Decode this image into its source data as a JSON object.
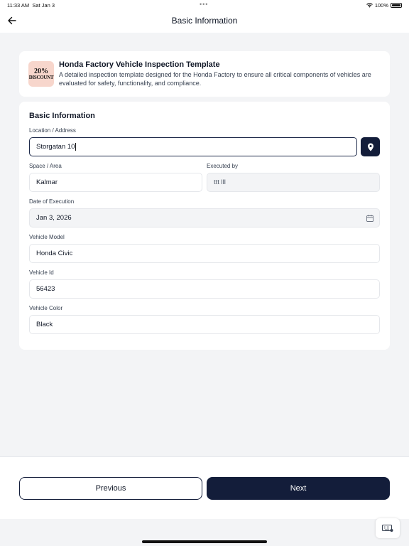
{
  "status_bar": {
    "time": "11:33 AM",
    "date": "Sat Jan 3",
    "battery": "100%"
  },
  "header": {
    "title": "Basic Information",
    "back_icon": "arrow-left-icon"
  },
  "template": {
    "logo_pct": "20%",
    "logo_word": "DISCOUNT",
    "title": "Honda Factory Vehicle Inspection Template",
    "description": "A detailed inspection template designed for the Honda Factory to ensure all critical components of vehicles are evaluated for safety, functionality, and compliance."
  },
  "form": {
    "section_title": "Basic Information",
    "location": {
      "label": "Location / Address",
      "value": "Storgatan 10"
    },
    "space": {
      "label": "Space / Area",
      "value": "Kalmar"
    },
    "executed_by": {
      "label": "Executed by",
      "value": "ttt lll"
    },
    "date": {
      "label": "Date of Execution",
      "value": "Jan 3, 2026"
    },
    "vehicle_model": {
      "label": "Vehicle Model",
      "value": "Honda Civic"
    },
    "vehicle_id": {
      "label": "Vehicle Id",
      "value": "56423"
    },
    "vehicle_color": {
      "label": "Vehicle Color",
      "value": "Black"
    }
  },
  "footer": {
    "previous_label": "Previous",
    "next_label": "Next"
  },
  "colors": {
    "primary": "#131d3a",
    "background": "#f3f4f6",
    "logo_bg": "#f7d6cc"
  }
}
